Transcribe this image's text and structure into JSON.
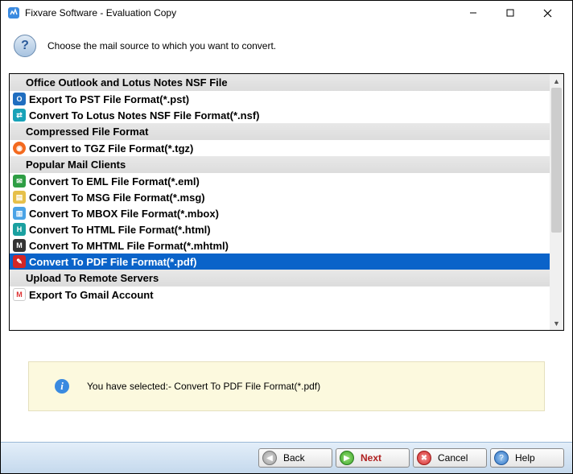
{
  "window": {
    "title": "Fixvare Software - Evaluation Copy"
  },
  "header": {
    "prompt": "Choose the mail source to which you want to convert."
  },
  "groups": [
    {
      "title": "Office Outlook and Lotus Notes NSF File",
      "items": [
        {
          "id": "pst",
          "label": "Export To PST File Format(*.pst)",
          "icon_class": "fi-pst",
          "glyph": "O"
        },
        {
          "id": "nsf",
          "label": "Convert To Lotus Notes NSF File Format(*.nsf)",
          "icon_class": "fi-nsf",
          "glyph": "⇄"
        }
      ]
    },
    {
      "title": "Compressed File Format",
      "items": [
        {
          "id": "tgz",
          "label": "Convert to TGZ File Format(*.tgz)",
          "icon_class": "fi-tgz",
          "glyph": "◉"
        }
      ]
    },
    {
      "title": "Popular Mail Clients",
      "items": [
        {
          "id": "eml",
          "label": "Convert To EML File Format(*.eml)",
          "icon_class": "fi-eml",
          "glyph": "✉"
        },
        {
          "id": "msg",
          "label": "Convert To MSG File Format(*.msg)",
          "icon_class": "fi-msg",
          "glyph": "▤"
        },
        {
          "id": "mbox",
          "label": "Convert To MBOX File Format(*.mbox)",
          "icon_class": "fi-mbox",
          "glyph": "▥"
        },
        {
          "id": "html",
          "label": "Convert To HTML File Format(*.html)",
          "icon_class": "fi-html",
          "glyph": "H"
        },
        {
          "id": "mhtml",
          "label": "Convert To MHTML File Format(*.mhtml)",
          "icon_class": "fi-mhtml",
          "glyph": "M"
        },
        {
          "id": "pdf",
          "label": "Convert To PDF File Format(*.pdf)",
          "icon_class": "fi-pdf",
          "glyph": "✎",
          "selected": true
        }
      ]
    },
    {
      "title": "Upload To Remote Servers",
      "items": [
        {
          "id": "gmail",
          "label": "Export To Gmail Account",
          "icon_class": "fi-gmail",
          "glyph": "M"
        }
      ]
    }
  ],
  "info": {
    "text": "You have selected:- Convert To PDF File Format(*.pdf)"
  },
  "footer": {
    "back": "Back",
    "next": "Next",
    "cancel": "Cancel",
    "help": "Help"
  }
}
